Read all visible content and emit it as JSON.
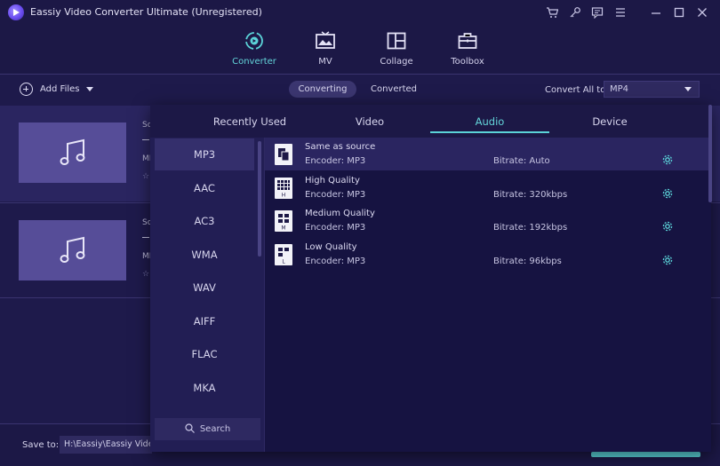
{
  "app": {
    "title": "Eassiy Video Converter Ultimate (Unregistered)"
  },
  "titlebar": {
    "icons": [
      "cart-icon",
      "key-icon",
      "feedback-icon",
      "menu-icon",
      "minimize-icon",
      "maximize-icon",
      "close-icon"
    ]
  },
  "nav": {
    "items": [
      {
        "label": "Converter",
        "icon": "converter-icon",
        "active": true
      },
      {
        "label": "MV",
        "icon": "mv-icon",
        "active": false
      },
      {
        "label": "Collage",
        "icon": "collage-icon",
        "active": false
      },
      {
        "label": "Toolbox",
        "icon": "toolbox-icon",
        "active": false
      }
    ]
  },
  "toolbar": {
    "add_files_label": "Add Files",
    "segments": [
      {
        "label": "Converting",
        "active": true
      },
      {
        "label": "Converted",
        "active": false
      }
    ],
    "convert_all_label": "Convert All to:",
    "convert_all_value": "MP4"
  },
  "files": [
    {
      "peek_top": "So",
      "peek_mid": "MI"
    },
    {
      "peek_top": "So",
      "peek_mid": "MI"
    }
  ],
  "bottom": {
    "save_label": "Save to:",
    "save_path": "H:\\Eassiy\\Eassiy Video"
  },
  "popup": {
    "tabs": [
      {
        "label": "Recently Used",
        "active": false
      },
      {
        "label": "Video",
        "active": false
      },
      {
        "label": "Audio",
        "active": true
      },
      {
        "label": "Device",
        "active": false
      }
    ],
    "formats": [
      {
        "label": "MP3",
        "active": true
      },
      {
        "label": "AAC",
        "active": false
      },
      {
        "label": "AC3",
        "active": false
      },
      {
        "label": "WMA",
        "active": false
      },
      {
        "label": "WAV",
        "active": false
      },
      {
        "label": "AIFF",
        "active": false
      },
      {
        "label": "FLAC",
        "active": false
      },
      {
        "label": "MKA",
        "active": false
      }
    ],
    "search_label": "Search",
    "presets": [
      {
        "name": "Same as source",
        "encoder": "Encoder: MP3",
        "bitrate": "Bitrate: Auto",
        "badge": "",
        "active": true
      },
      {
        "name": "High Quality",
        "encoder": "Encoder: MP3",
        "bitrate": "Bitrate: 320kbps",
        "badge": "H",
        "active": false
      },
      {
        "name": "Medium Quality",
        "encoder": "Encoder: MP3",
        "bitrate": "Bitrate: 192kbps",
        "badge": "M",
        "active": false
      },
      {
        "name": "Low Quality",
        "encoder": "Encoder: MP3",
        "bitrate": "Bitrate: 96kbps",
        "badge": "L",
        "active": false
      }
    ]
  },
  "colors": {
    "accent": "#5bd3d8",
    "background": "#1e1a4b",
    "panel": "#161341"
  }
}
